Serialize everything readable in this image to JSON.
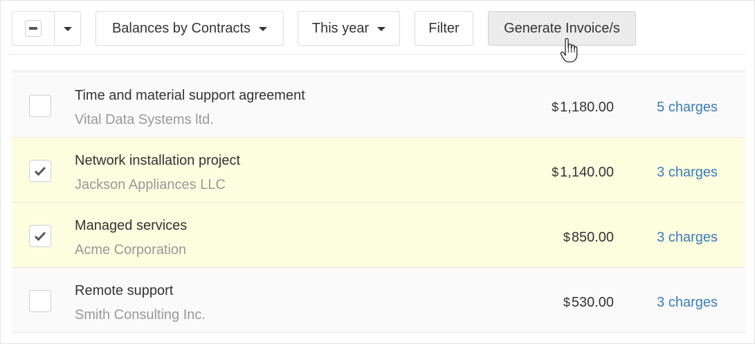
{
  "toolbar": {
    "group_selector": "Balances by Contracts",
    "period_selector": "This year",
    "filter_label": "Filter",
    "generate_label": "Generate Invoice/s"
  },
  "rows": [
    {
      "title": "Time and material support agreement",
      "client": "Vital Data Systems ltd.",
      "currency": "$",
      "amount": "1,180.00",
      "charges": "5 charges",
      "selected": false
    },
    {
      "title": "Network installation project",
      "client": "Jackson Appliances LLC",
      "currency": "$",
      "amount": "1,140.00",
      "charges": "3 charges",
      "selected": true
    },
    {
      "title": "Managed services",
      "client": "Acme Corporation",
      "currency": "$",
      "amount": "850.00",
      "charges": "3 charges",
      "selected": true
    },
    {
      "title": "Remote support",
      "client": "Smith Consulting Inc.",
      "currency": "$",
      "amount": "530.00",
      "charges": "3 charges",
      "selected": false
    }
  ],
  "colors": {
    "link": "#3a7cb8",
    "selected_row": "#fdfde0",
    "row": "#fafafa"
  },
  "icons": {
    "bulk_select": "minus-checkbox-icon",
    "dropdown": "caret-down-icon",
    "row_check": "checkmark-icon",
    "pointer": "hand-pointer-cursor-icon"
  }
}
